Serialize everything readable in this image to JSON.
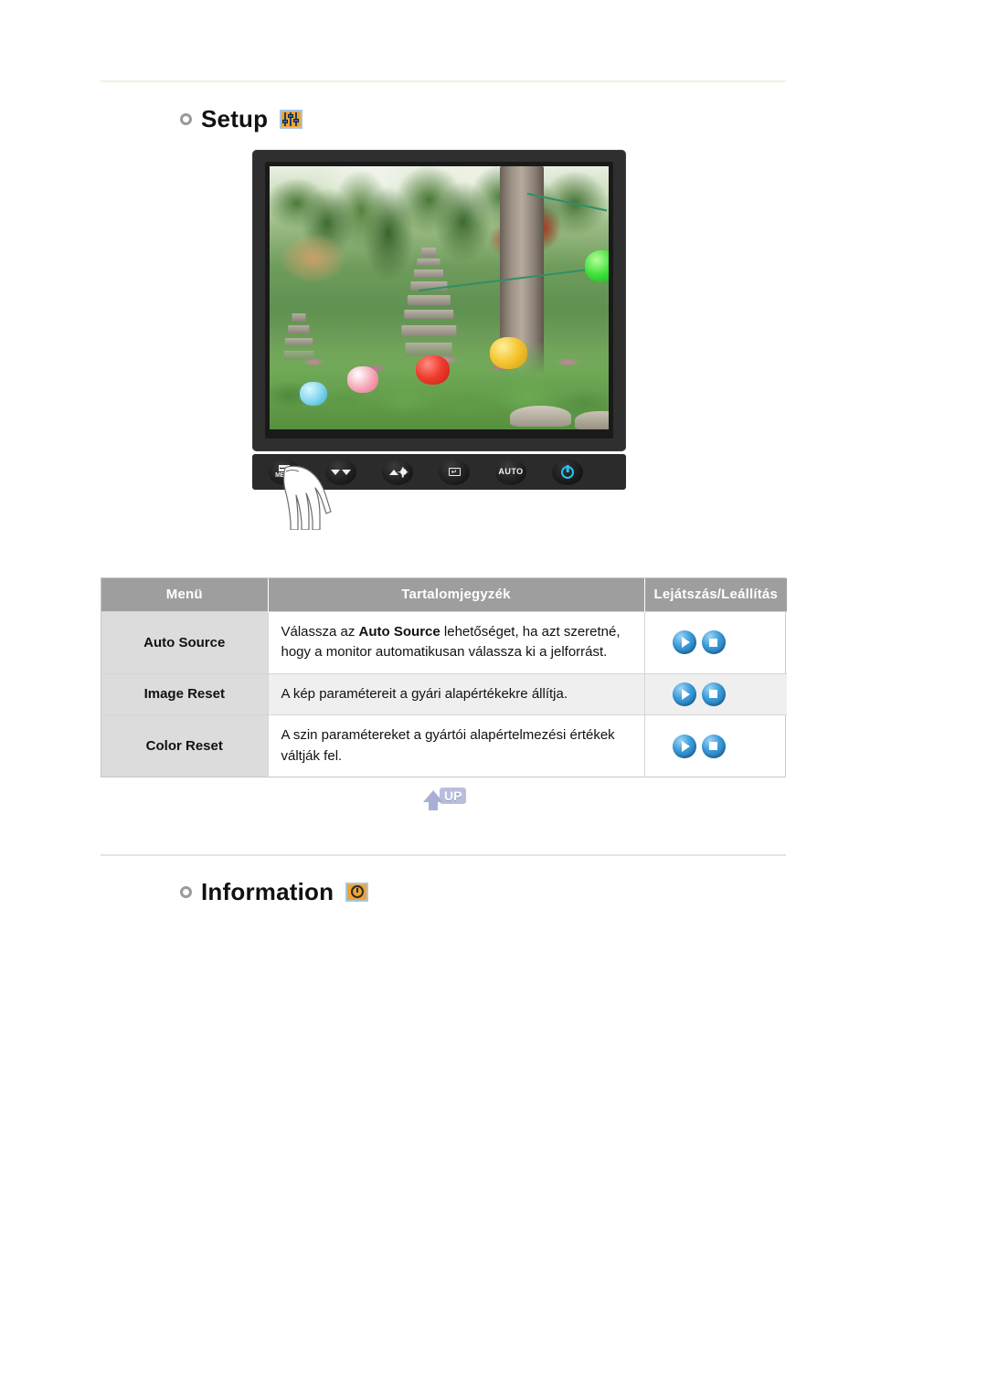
{
  "sections": {
    "setup": {
      "title": "Setup",
      "icon": "sliders-icon",
      "bullet": "circle-bullet"
    },
    "information": {
      "title": "Information",
      "icon": "clock-icon",
      "bullet": "circle-bullet"
    }
  },
  "monitor": {
    "alt": "monitor-display-garden-scene",
    "buttons": [
      {
        "name": "menu-button",
        "label": "MENU",
        "glyph": "menu-icon"
      },
      {
        "name": "down-button",
        "label": "",
        "glyph": "arrow-down-icon"
      },
      {
        "name": "brightness-button",
        "label": "",
        "glyph": "brightness-icon"
      },
      {
        "name": "enter-button",
        "label": "",
        "glyph": "enter-icon"
      },
      {
        "name": "auto-button",
        "label": "AUTO",
        "glyph": "auto-text"
      },
      {
        "name": "power-button",
        "label": "",
        "glyph": "power-icon"
      }
    ],
    "hand_pointer": "hand-pressing-menu"
  },
  "table": {
    "headers": [
      "Menü",
      "Tartalomjegyzék",
      "Lejátszás/Leállítás"
    ],
    "rows": [
      {
        "menu": "Auto Source",
        "content_prefix": "Válassza az ",
        "content_bold": "Auto Source",
        "content_suffix": " lehetőséget, ha azt szeretné, hogy a monitor automatikusan válassza ki a jelforrást.",
        "play_label": "Lejátszás",
        "stop_label": "Leállítás"
      },
      {
        "menu": "Image Reset",
        "content_prefix": "A kép paramétereit a gyári alapértékekre állítja.",
        "content_bold": "",
        "content_suffix": "",
        "play_label": "Lejátszás",
        "stop_label": "Leállítás"
      },
      {
        "menu": "Color Reset",
        "content_prefix": "A szin paramétereket a gyártói alapértelmezési értékek váltják fel.",
        "content_bold": "",
        "content_suffix": "",
        "play_label": "Lejátszás",
        "stop_label": "Leállítás"
      }
    ]
  },
  "up_button": {
    "label": "UP",
    "icon": "arrow-up-icon"
  },
  "colors": {
    "header_bg": "#9e9e9e",
    "menu_cell_bg": "#dcdcdc",
    "alt_row_bg": "#efefef",
    "icon_orange": "#eda432",
    "play_blue": "#3b9ddc",
    "power_cyan": "#23c6f2",
    "up_lavender": "#a9b0d6",
    "rule_top": "#f3efe2",
    "rule_mid": "#e4e4e4"
  }
}
